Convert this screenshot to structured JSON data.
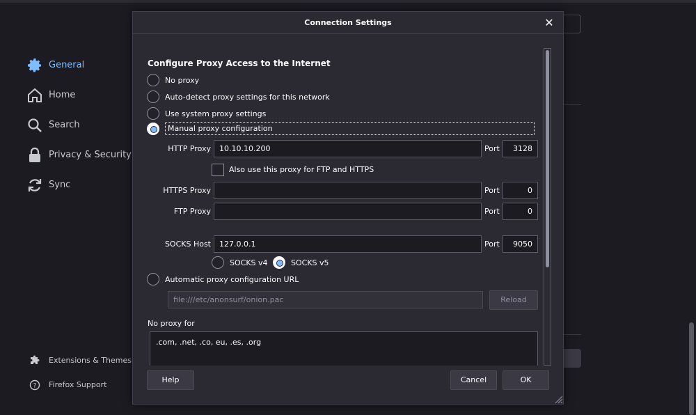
{
  "sidebar": {
    "items": [
      {
        "label": "General",
        "icon": "gear-icon",
        "active": true
      },
      {
        "label": "Home",
        "icon": "home-icon",
        "active": false
      },
      {
        "label": "Search",
        "icon": "search-icon",
        "active": false
      },
      {
        "label": "Privacy & Security",
        "icon": "lock-icon",
        "active": false
      },
      {
        "label": "Sync",
        "icon": "sync-icon",
        "active": false
      }
    ],
    "footer": [
      {
        "label": "Extensions & Themes",
        "icon": "puzzle-icon"
      },
      {
        "label": "Firefox Support",
        "icon": "help-icon"
      }
    ]
  },
  "dialog": {
    "title": "Connection Settings",
    "section_title": "Configure Proxy Access to the Internet",
    "options": {
      "no_proxy": "No proxy",
      "auto_detect": "Auto-detect proxy settings for this network",
      "system": "Use system proxy settings",
      "manual": "Manual proxy configuration",
      "auto_url": "Automatic proxy configuration URL"
    },
    "selected_option": "manual",
    "http": {
      "label": "HTTP Proxy",
      "value": "10.10.10.200",
      "port_label": "Port",
      "port": "3128"
    },
    "also_use": "Also use this proxy for FTP and HTTPS",
    "https": {
      "label": "HTTPS Proxy",
      "value": "",
      "port_label": "Port",
      "port": "0"
    },
    "ftp": {
      "label": "FTP Proxy",
      "value": "",
      "port_label": "Port",
      "port": "0"
    },
    "socks": {
      "label": "SOCKS Host",
      "value": "127.0.0.1",
      "port_label": "Port",
      "port": "9050",
      "v4": "SOCKS v4",
      "v5": "SOCKS v5",
      "selected_version": "v5"
    },
    "pac_url": "file:///etc/anonsurf/onion.pac",
    "reload": "Reload",
    "no_proxy_for_label": "No proxy for",
    "no_proxy_for_value": ".com, .net, .co, eu, .es, .org",
    "buttons": {
      "help": "Help",
      "cancel": "Cancel",
      "ok": "OK"
    }
  },
  "colors": {
    "accent": "#80bdff",
    "dialog_bg": "#2b2a33",
    "page_bg": "#1c1b22"
  }
}
